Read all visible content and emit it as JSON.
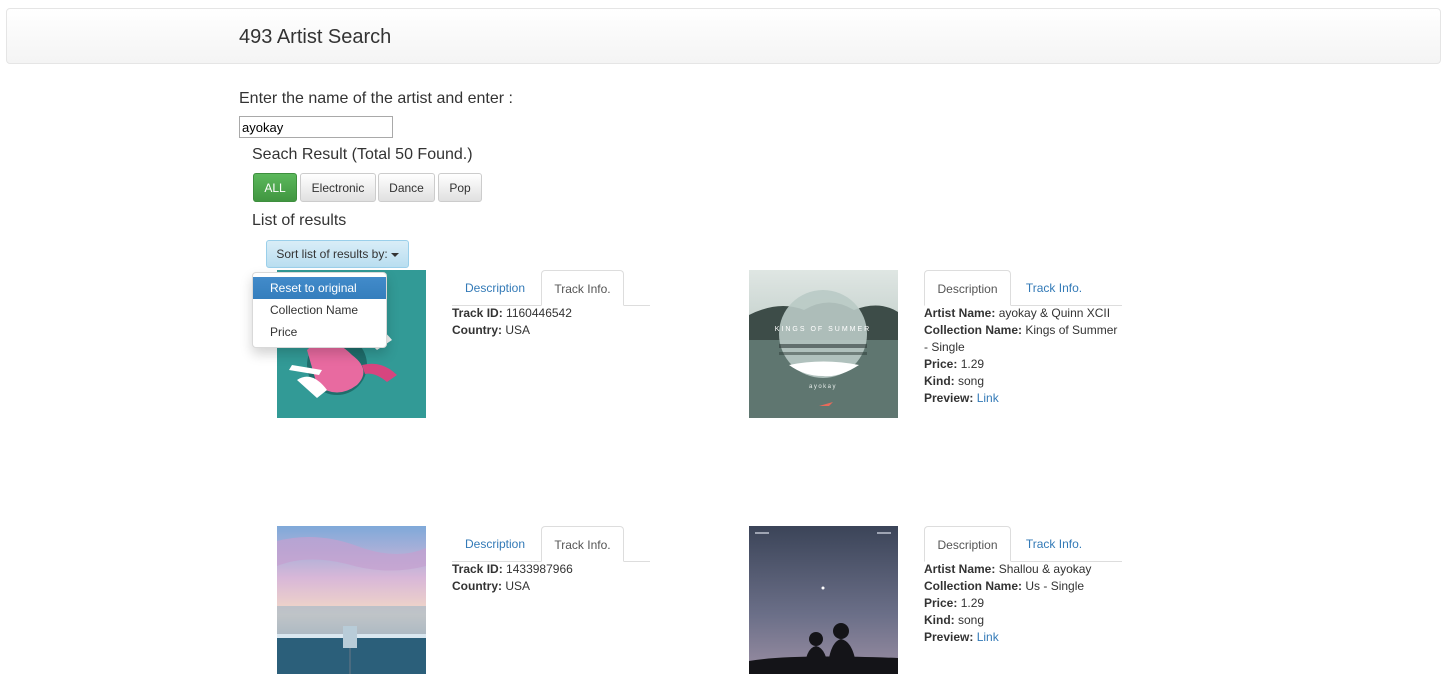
{
  "header": {
    "title": "493 Artist Search"
  },
  "search": {
    "prompt": "Enter the name of the artist and enter :",
    "value": "ayokay"
  },
  "results": {
    "count_text": "Seach Result (Total 50 Found.)",
    "list_title": "List of results"
  },
  "filters": [
    "ALL",
    "Electronic",
    "Dance",
    "Pop"
  ],
  "sort": {
    "label": "Sort list of results by:",
    "options": [
      "Reset to original",
      "Collection Name",
      "Price"
    ]
  },
  "tabs": {
    "description": "Description",
    "track_info": "Track Info."
  },
  "labels": {
    "track_id": "Track ID:",
    "country": "Country:",
    "artist_name": "Artist Name:",
    "collection_name": "Collection Name:",
    "price": "Price:",
    "kind": "Kind:",
    "preview": "Preview:",
    "link": "Link"
  },
  "items": [
    {
      "track_id": "1160446542",
      "country": "USA"
    },
    {
      "artist_name": "ayokay & Quinn XCII",
      "collection_name": "Kings of Summer - Single",
      "price": "1.29",
      "kind": "song",
      "art_text": "KINGS OF SUMMER",
      "art_subtext": "ayokay"
    },
    {
      "track_id": "1433987966",
      "country": "USA"
    },
    {
      "artist_name": "Shallou & ayokay",
      "collection_name": "Us - Single",
      "price": "1.29",
      "kind": "song"
    }
  ]
}
